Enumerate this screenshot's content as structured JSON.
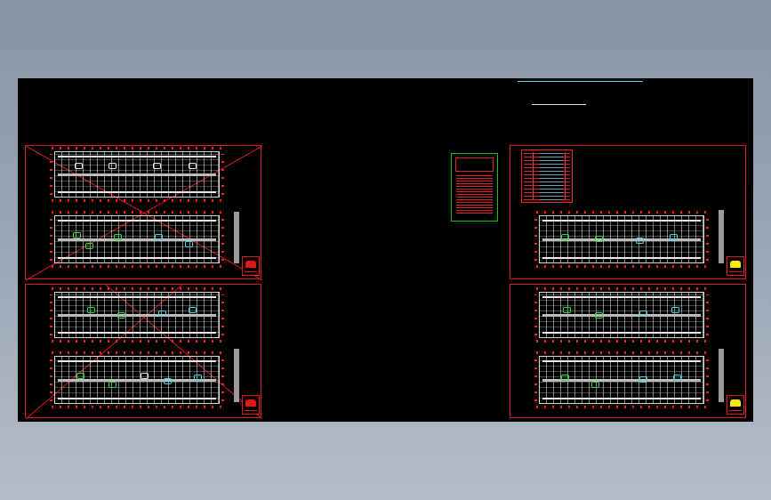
{
  "colors": {
    "background_gradient_top": "#8893a4",
    "model_space": "#000000",
    "sheet_border": "#e01818",
    "legend_border": "#18c018",
    "fixture_green": "#22e03a",
    "fixture_cyan": "#3fd8e8",
    "stamp_yellow": "#ffe800",
    "header_line_cyan": "#3fd8e8"
  },
  "icons": {
    "title_stamp": "stamp-icon"
  },
  "legend": {
    "title": ""
  },
  "notes": {
    "title": ""
  }
}
